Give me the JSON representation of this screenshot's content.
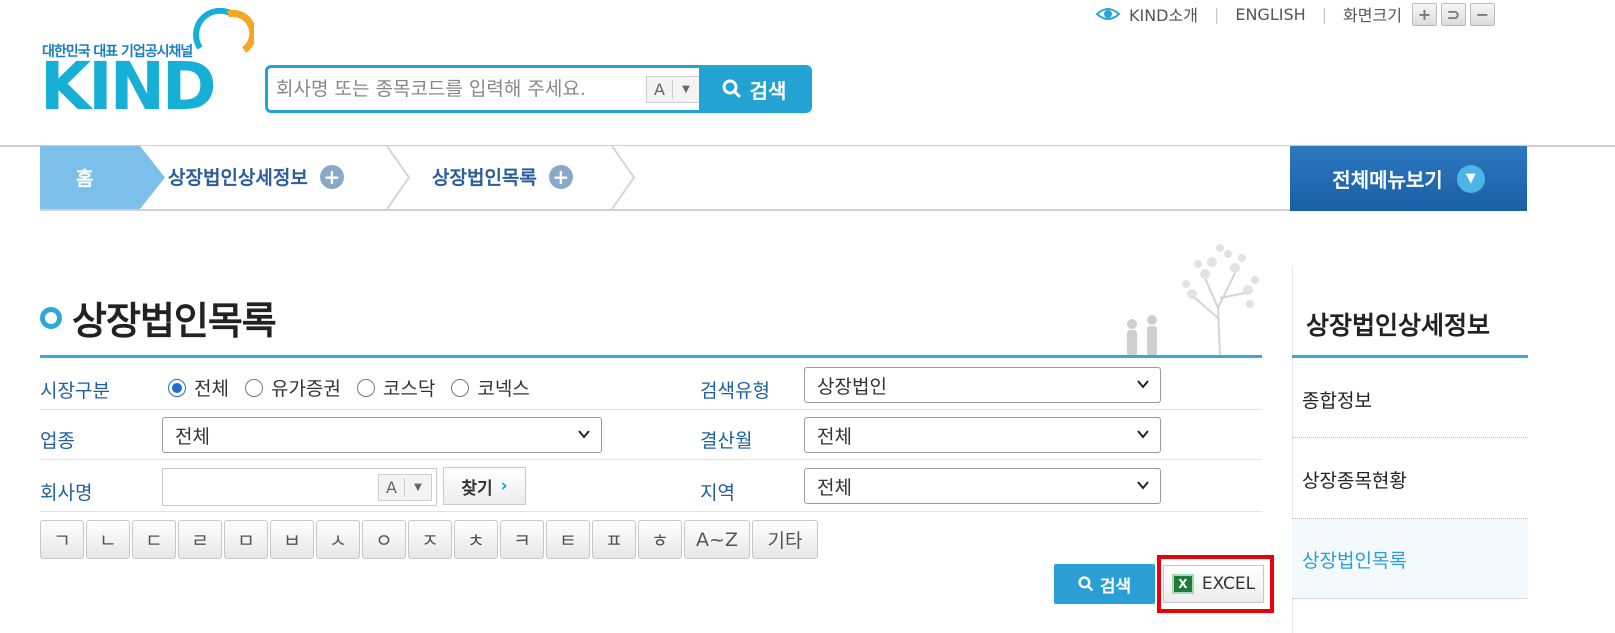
{
  "header": {
    "logo_tagline": "대한민국 대표 기업공시채널",
    "logo_word": "KIND",
    "search_placeholder": "회사명 또는 종목코드를 입력해 주세요.",
    "search_font_toggle": "A",
    "search_button_label": "검색",
    "util": {
      "kind_intro": "KIND소개",
      "english": "ENGLISH",
      "screen_size": "화면크기",
      "zoom_in": "+",
      "reset": "⊃",
      "zoom_out": "−"
    }
  },
  "breadcrumb": {
    "home": "홈",
    "items": [
      "상장법인상세정보",
      "상장법인목록"
    ],
    "all_menu": "전체메뉴보기"
  },
  "page": {
    "title": "상장법인목록"
  },
  "form": {
    "market_label": "시장구분",
    "market_options": [
      "전체",
      "유가증권",
      "코스닥",
      "코넥스"
    ],
    "market_selected": "전체",
    "search_type_label": "검색유형",
    "search_type_value": "상장법인",
    "industry_label": "업종",
    "industry_value": "전체",
    "fiscal_month_label": "결산월",
    "fiscal_month_value": "전체",
    "company_label": "회사명",
    "company_value": "",
    "company_font_toggle": "A",
    "find_button": "찾기",
    "region_label": "지역",
    "region_value": "전체",
    "initials": [
      "ㄱ",
      "ㄴ",
      "ㄷ",
      "ㄹ",
      "ㅁ",
      "ㅂ",
      "ㅅ",
      "ㅇ",
      "ㅈ",
      "ㅊ",
      "ㅋ",
      "ㅌ",
      "ㅍ",
      "ㅎ",
      "A~Z",
      "기타"
    ],
    "search_button": "검색",
    "excel_button": "EXCEL"
  },
  "sidebar": {
    "title": "상장법인상세정보",
    "items": [
      "종합정보",
      "상장종목현황",
      "상장법인목록"
    ],
    "active": "상장법인목록"
  },
  "colors": {
    "accent": "#22a3d4",
    "nav_blue": "#1a5fa5",
    "label_blue": "#1f5fa0",
    "highlight_red": "#e8000b"
  }
}
